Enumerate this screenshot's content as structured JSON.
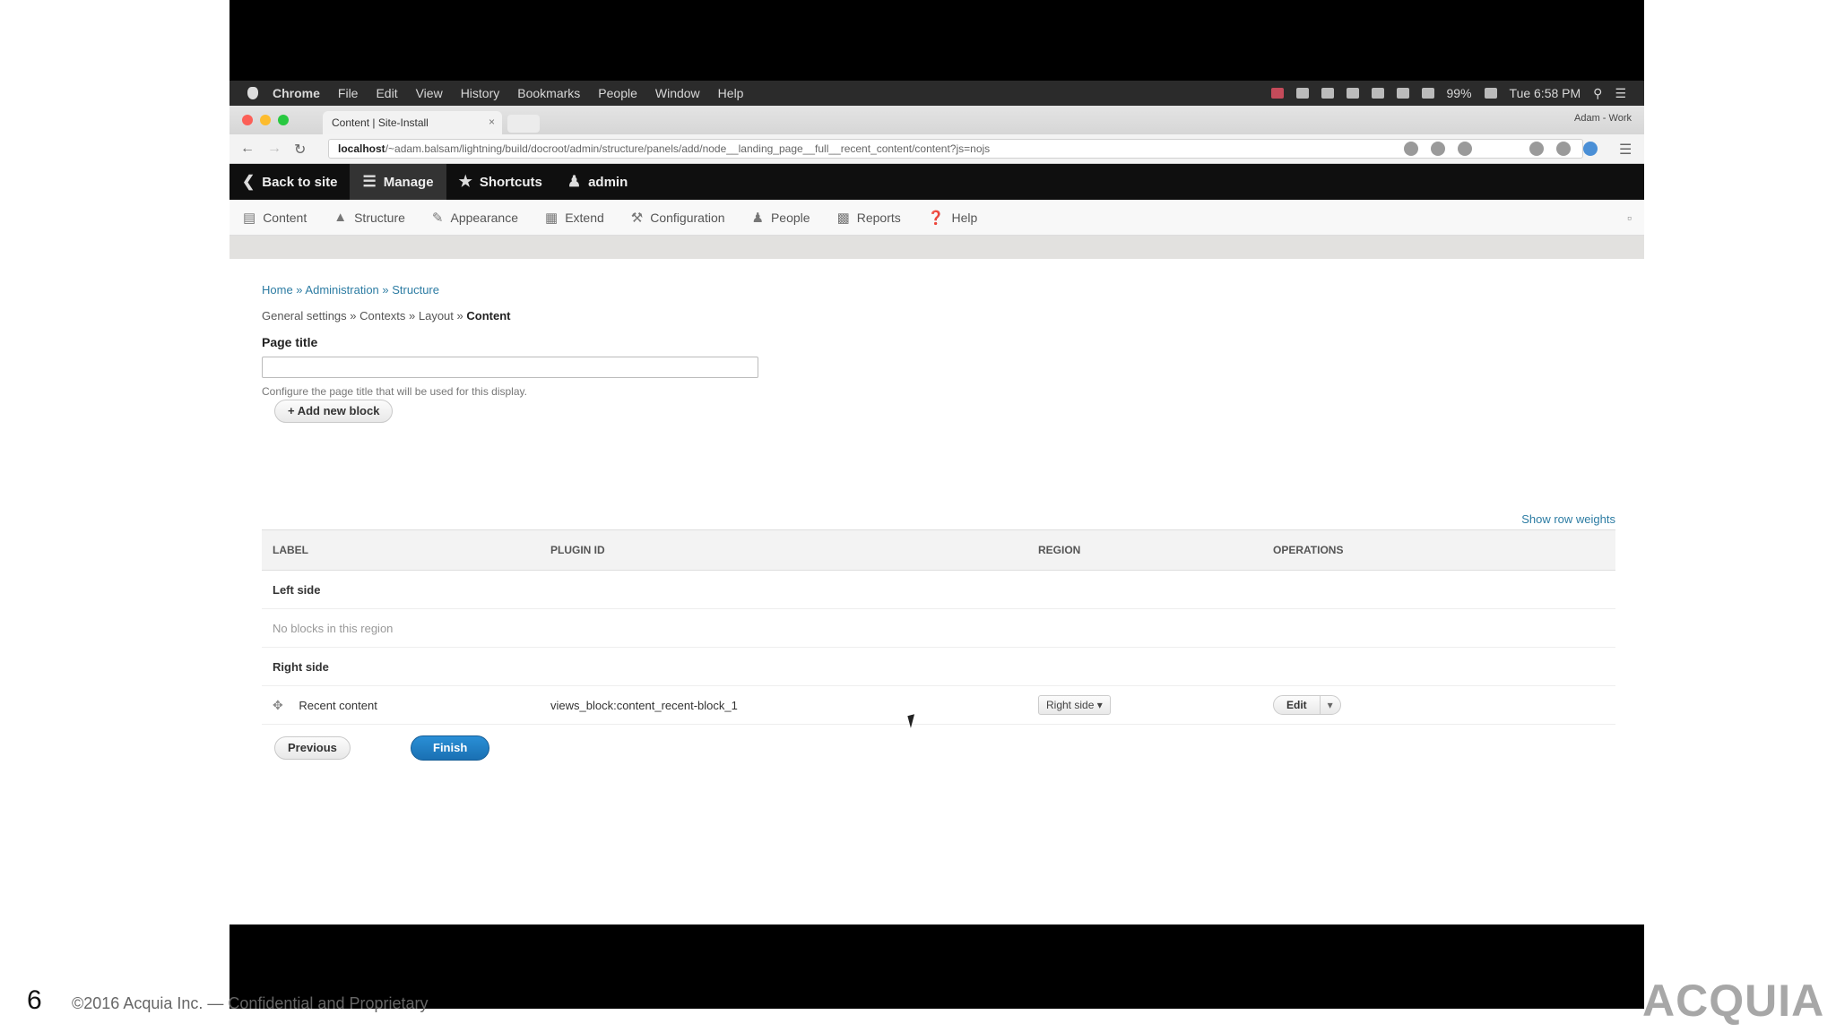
{
  "slide": {
    "number": "6",
    "copyright": "©2016 Acquia Inc. — Confidential and Proprietary",
    "logo": "ACQUIA"
  },
  "mac_menubar": {
    "items": [
      "Chrome",
      "File",
      "Edit",
      "View",
      "History",
      "Bookmarks",
      "People",
      "Window",
      "Help"
    ],
    "battery": "99%",
    "clock": "Tue 6:58 PM"
  },
  "browser": {
    "tab_title": "Content | Site-Install",
    "profile": "Adam - Work",
    "url_host": "localhost",
    "url_path": "/~adam.balsam/lightning/build/docroot/admin/structure/panels/add/node__landing_page__full__recent_content/content?js=nojs"
  },
  "drupal_toolbar": {
    "items": [
      {
        "label": "Back to site",
        "icon": "back-icon"
      },
      {
        "label": "Manage",
        "icon": "hamburger-icon"
      },
      {
        "label": "Shortcuts",
        "icon": "star-icon"
      },
      {
        "label": "admin",
        "icon": "user-icon"
      }
    ],
    "tray": [
      {
        "label": "Content",
        "icon": "content-icon"
      },
      {
        "label": "Structure",
        "icon": "structure-icon"
      },
      {
        "label": "Appearance",
        "icon": "brush-icon"
      },
      {
        "label": "Extend",
        "icon": "puzzle-icon"
      },
      {
        "label": "Configuration",
        "icon": "wrench-icon"
      },
      {
        "label": "People",
        "icon": "people-icon"
      },
      {
        "label": "Reports",
        "icon": "chart-icon"
      },
      {
        "label": "Help",
        "icon": "help-icon"
      }
    ]
  },
  "page": {
    "breadcrumb": "Home » Administration » Structure",
    "steps_prefix": "General settings » Contexts » Layout » ",
    "steps_current": "Content",
    "page_title_label": "Page title",
    "page_title_value": "",
    "page_title_desc": "Configure the page title that will be used for this display.",
    "add_block_label": "+ Add new block",
    "show_weights": "Show row weights",
    "table": {
      "headers": [
        "LABEL",
        "PLUGIN ID",
        "REGION",
        "OPERATIONS"
      ],
      "left_region": "Left side",
      "empty_message": "No blocks in this region",
      "right_region": "Right side",
      "row": {
        "label": "Recent content",
        "plugin_id": "views_block:content_recent-block_1",
        "region": "Right side",
        "operation": "Edit"
      }
    },
    "previous_label": "Previous",
    "finish_label": "Finish"
  }
}
